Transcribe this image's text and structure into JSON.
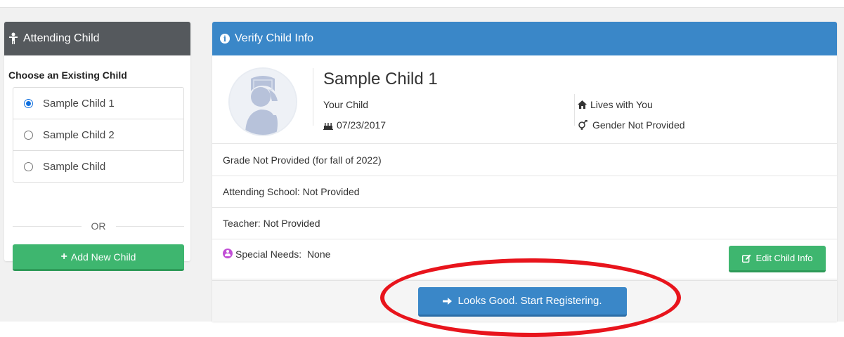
{
  "left_panel": {
    "title": "Attending Child",
    "choose_label": "Choose an Existing Child",
    "children": [
      {
        "name": "Sample Child 1",
        "selected": true
      },
      {
        "name": "Sample Child 2",
        "selected": false
      },
      {
        "name": "Sample Child",
        "selected": false
      }
    ],
    "or_label": "OR",
    "add_button": "Add New Child"
  },
  "verify_panel": {
    "title": "Verify Child Info",
    "child_name": "Sample Child 1",
    "relation": "Your Child",
    "dob": "07/23/2017",
    "lives_with": "Lives with You",
    "gender": "Gender Not Provided",
    "grade": "Grade Not Provided (for fall of 2022)",
    "school": "Attending School:  Not Provided",
    "teacher": "Teacher:  Not Provided",
    "special_needs": "Special Needs:  None",
    "edit_button": "Edit Child Info",
    "start_button": "Looks Good. Start Registering."
  },
  "colors": {
    "left_header": "#55595d",
    "blue_header": "#3a87c8",
    "green_button": "#3eb66f",
    "annotation_circle": "#e8141c"
  },
  "icons": [
    "child-icon",
    "info-icon",
    "home-icon",
    "birthday-cake-icon",
    "gender-icon",
    "special-needs-icon",
    "edit-icon",
    "arrow-right-icon",
    "plus-icon"
  ]
}
